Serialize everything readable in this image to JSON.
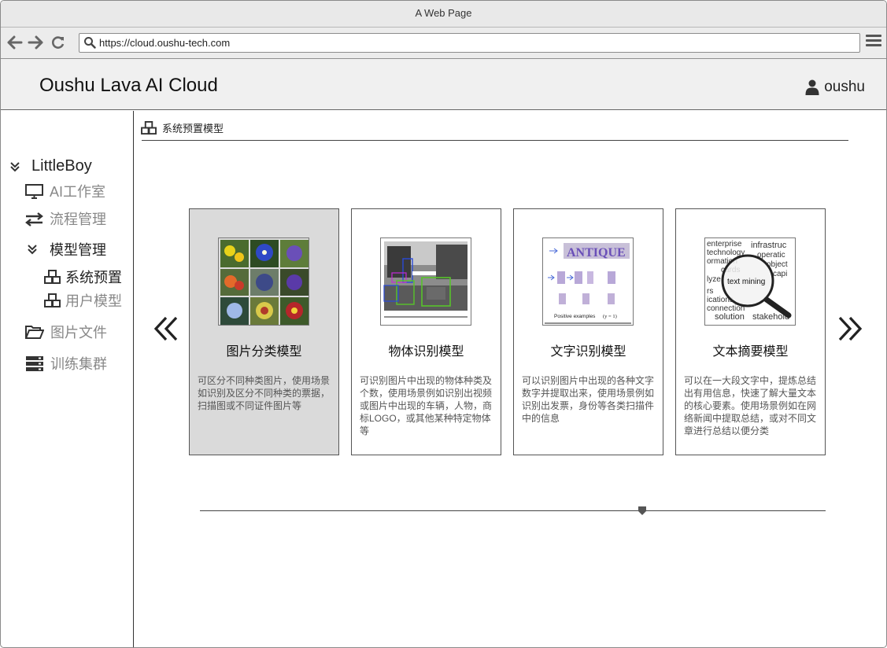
{
  "browser": {
    "title": "A Web Page",
    "url": "https://cloud.oushu-tech.com"
  },
  "header": {
    "brand": "Oushu Lava AI Cloud",
    "username": "oushu"
  },
  "sidebar": {
    "root": "LittleBoy",
    "items": [
      {
        "label": "AI工作室",
        "icon": "monitor-icon"
      },
      {
        "label": "流程管理",
        "icon": "transfer-arrows-icon"
      },
      {
        "label": "模型管理",
        "icon": "chevron-double-down-icon"
      },
      {
        "label": "系统预置",
        "icon": "cubes-icon"
      },
      {
        "label": "用户模型",
        "icon": "cubes-icon"
      },
      {
        "label": "图片文件",
        "icon": "folder-open-icon"
      },
      {
        "label": "训练集群",
        "icon": "server-icon"
      }
    ]
  },
  "main": {
    "breadcrumb": "系统预置模型",
    "prev_icon": "double-chevron-left-icon",
    "next_icon": "double-chevron-right-icon",
    "cards": [
      {
        "title": "图片分类模型",
        "description": "可区分不同种类图片，使用场景如识别及区分不同种类的票据，扫描图或不同证件图片等",
        "selected": true
      },
      {
        "title": "物体识别模型",
        "description": "可识别图片中出现的物体种类及个数，使用场景例如识别出视频或图片中出现的车辆，人物，商标LOGO，或其他某种特定物体等"
      },
      {
        "title": "文字识别模型",
        "description": "可以识别图片中出现的各种文字数字并提取出来，使用场景例如识别出发票，身份等各类扫描件中的信息",
        "thumb_text": [
          "ANTIQUE",
          "Positive examples",
          "(y = 1)"
        ]
      },
      {
        "title": "文本摘要模型",
        "description": "可以在一大段文字中，提炼总结出有用信息，快速了解大量文本的核心要素。使用场景例如在网络新闻中提取总结，或对不同文章进行总结以便分类",
        "thumb_words": [
          "enterprise",
          "infrastruc",
          "technology",
          "operatic",
          "ormation",
          "object",
          "cards",
          "capi",
          "lyze",
          "text mining",
          "rs",
          "ications",
          "connection",
          "solution",
          "stakehold"
        ]
      }
    ]
  },
  "colors": {
    "selected_card": "#dadada",
    "sidebar_muted": "#888888",
    "header_bg": "#f0f0f0"
  }
}
